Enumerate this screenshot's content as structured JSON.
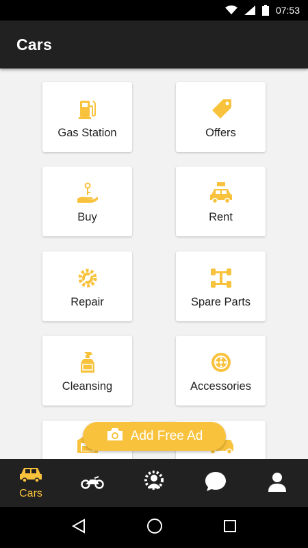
{
  "status_bar": {
    "time": "07:53"
  },
  "app_bar": {
    "title": "Cars"
  },
  "tiles": [
    {
      "label": "Gas Station",
      "icon": "gas-station-icon"
    },
    {
      "label": "Offers",
      "icon": "price-tag-icon"
    },
    {
      "label": "Buy",
      "icon": "hand-key-icon"
    },
    {
      "label": "Rent",
      "icon": "rent-car-icon"
    },
    {
      "label": "Repair",
      "icon": "gear-wrench-icon"
    },
    {
      "label": "Spare Parts",
      "icon": "axle-icon"
    },
    {
      "label": "Cleansing",
      "icon": "spray-bottle-icon"
    },
    {
      "label": "Accessories",
      "icon": "wheel-icon"
    },
    {
      "label": "",
      "icon": "car-wash-icon"
    },
    {
      "label": "",
      "icon": "tow-truck-icon"
    }
  ],
  "fab": {
    "label": "Add Free Ad",
    "icon": "camera-icon"
  },
  "bottom_nav": [
    {
      "label": "Cars",
      "icon": "car-icon",
      "active": true
    },
    {
      "label": "",
      "icon": "motorcycle-icon",
      "active": false
    },
    {
      "label": "",
      "icon": "user-gear-icon",
      "active": false
    },
    {
      "label": "",
      "icon": "chat-bubble-icon",
      "active": false
    },
    {
      "label": "",
      "icon": "profile-icon",
      "active": false
    }
  ],
  "colors": {
    "accent": "#f9c23c",
    "app_bar": "#212121",
    "background": "#f2f2f2"
  }
}
